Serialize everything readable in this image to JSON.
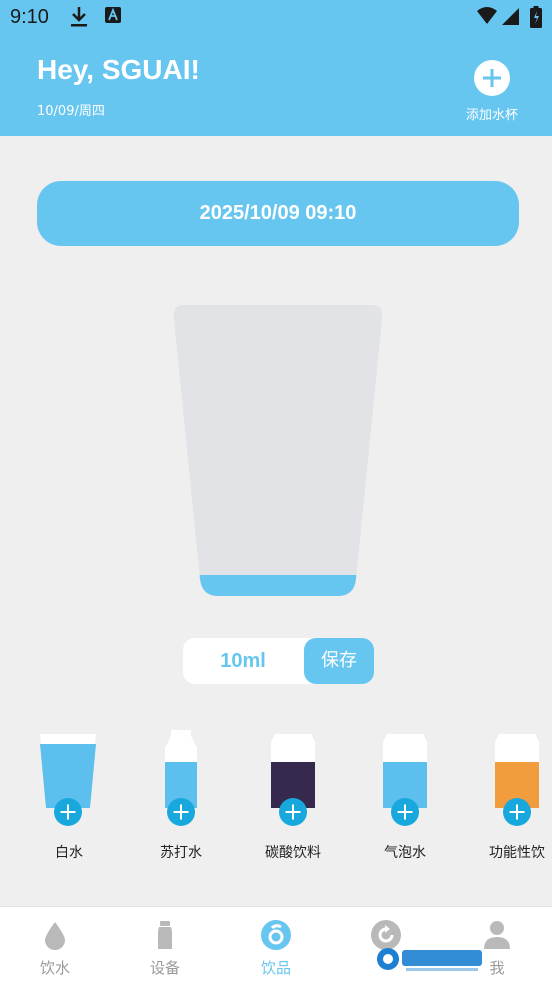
{
  "status_bar": {
    "time": "9:10"
  },
  "header": {
    "greeting": "Hey, SGUAI!",
    "date": "10/09/周四",
    "add_cup_label": "添加水杯"
  },
  "datetime_display": "2025/10/09 09:10",
  "amount": {
    "value": "10ml",
    "save_label": "保存"
  },
  "drinks": [
    {
      "label": "白水",
      "color": "#5dbfee"
    },
    {
      "label": "苏打水",
      "color": "#5dbfee"
    },
    {
      "label": "碳酸饮料",
      "color": "#352a4e"
    },
    {
      "label": "气泡水",
      "color": "#5dbfee"
    },
    {
      "label": "功能性饮",
      "color": "#f19d3d"
    }
  ],
  "bottom_nav": [
    {
      "label": "饮水",
      "icon": "drop-icon"
    },
    {
      "label": "设备",
      "icon": "bottle-icon"
    },
    {
      "label": "饮品",
      "icon": "drinks-icon",
      "active": true
    },
    {
      "label": "",
      "icon": "refresh-icon"
    },
    {
      "label": "我",
      "icon": "person-icon"
    }
  ],
  "colors": {
    "accent": "#67c6f0",
    "badge": "#19a8de",
    "background": "#efefef"
  }
}
